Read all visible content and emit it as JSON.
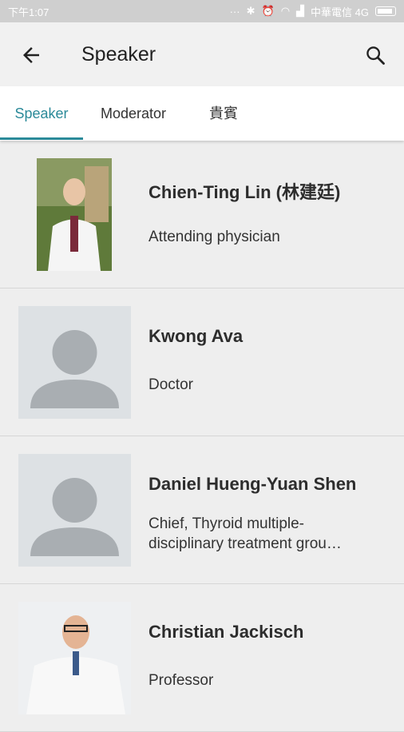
{
  "status_bar": {
    "time": "下午1:07",
    "carrier": "中華電信 4G"
  },
  "header": {
    "title": "Speaker"
  },
  "tabs": [
    {
      "label": "Speaker",
      "active": true
    },
    {
      "label": "Moderator",
      "active": false
    },
    {
      "label": "貴賓",
      "active": false
    }
  ],
  "speakers": [
    {
      "name": "Chien-Ting Lin (林建廷)",
      "role": "Attending physician",
      "avatar": "photo"
    },
    {
      "name": "Kwong Ava",
      "role": "Doctor",
      "avatar": "placeholder"
    },
    {
      "name": "Daniel Hueng-Yuan Shen",
      "role_line1": "Chief, Thyroid multiple-",
      "role_line2": "disciplinary treatment grou…",
      "avatar": "placeholder"
    },
    {
      "name": "Christian Jackisch",
      "role": "Professor",
      "avatar": "photo"
    }
  ],
  "colors": {
    "accent": "#2b8a99",
    "placeholder_bg": "#dde1e4",
    "placeholder_figure": "#a9aeb2"
  }
}
